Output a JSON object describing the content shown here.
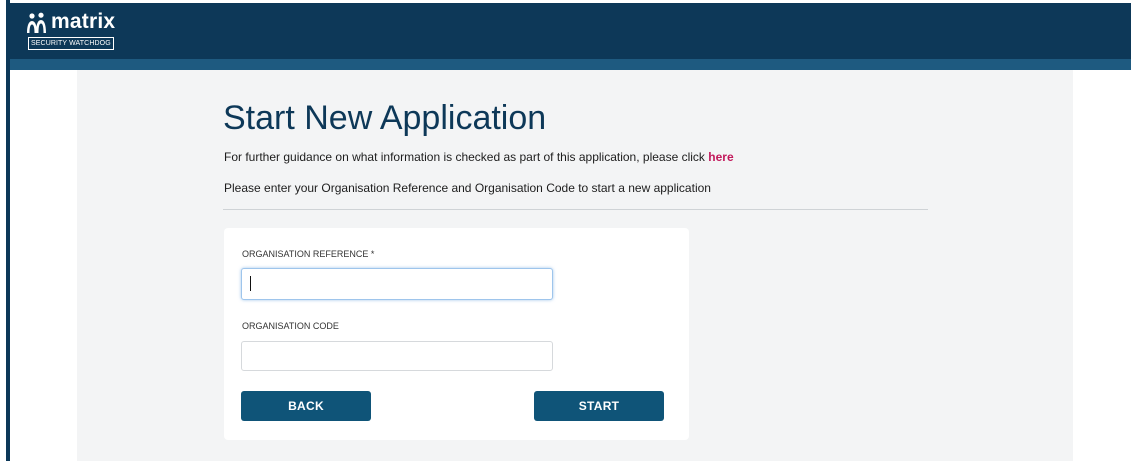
{
  "header": {
    "logo": {
      "wordmark": "matrix",
      "tagline": "SECURITY WATCHDOG",
      "icon": "people-icon"
    }
  },
  "main": {
    "title": "Start New Application",
    "guidance_text": "For further guidance on what information is checked as part of this application, please click ",
    "guidance_link": "here",
    "instructions": "Please enter your Organisation Reference and Organisation Code to start a new application"
  },
  "form": {
    "reference_label": "ORGANISATION REFERENCE *",
    "reference_value": "",
    "code_label": "ORGANISATION CODE",
    "code_value": "",
    "back_label": "BACK",
    "start_label": "START"
  },
  "colors": {
    "header": "#0d3858",
    "accent_bar": "#1e5a80",
    "button": "#0f5478",
    "link": "#c2185b",
    "content_bg": "#f3f4f5"
  }
}
